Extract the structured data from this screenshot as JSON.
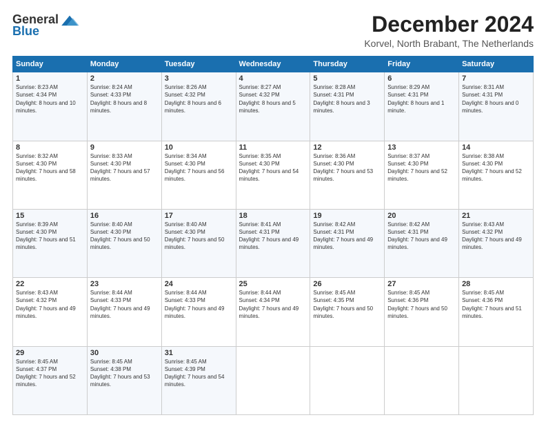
{
  "logo": {
    "general": "General",
    "blue": "Blue"
  },
  "title": "December 2024",
  "subtitle": "Korvel, North Brabant, The Netherlands",
  "weekdays": [
    "Sunday",
    "Monday",
    "Tuesday",
    "Wednesday",
    "Thursday",
    "Friday",
    "Saturday"
  ],
  "weeks": [
    [
      {
        "day": "1",
        "sunrise": "8:23 AM",
        "sunset": "4:34 PM",
        "daylight": "8 hours and 10 minutes."
      },
      {
        "day": "2",
        "sunrise": "8:24 AM",
        "sunset": "4:33 PM",
        "daylight": "8 hours and 8 minutes."
      },
      {
        "day": "3",
        "sunrise": "8:26 AM",
        "sunset": "4:32 PM",
        "daylight": "8 hours and 6 minutes."
      },
      {
        "day": "4",
        "sunrise": "8:27 AM",
        "sunset": "4:32 PM",
        "daylight": "8 hours and 5 minutes."
      },
      {
        "day": "5",
        "sunrise": "8:28 AM",
        "sunset": "4:31 PM",
        "daylight": "8 hours and 3 minutes."
      },
      {
        "day": "6",
        "sunrise": "8:29 AM",
        "sunset": "4:31 PM",
        "daylight": "8 hours and 1 minute."
      },
      {
        "day": "7",
        "sunrise": "8:31 AM",
        "sunset": "4:31 PM",
        "daylight": "8 hours and 0 minutes."
      }
    ],
    [
      {
        "day": "8",
        "sunrise": "8:32 AM",
        "sunset": "4:30 PM",
        "daylight": "7 hours and 58 minutes."
      },
      {
        "day": "9",
        "sunrise": "8:33 AM",
        "sunset": "4:30 PM",
        "daylight": "7 hours and 57 minutes."
      },
      {
        "day": "10",
        "sunrise": "8:34 AM",
        "sunset": "4:30 PM",
        "daylight": "7 hours and 56 minutes."
      },
      {
        "day": "11",
        "sunrise": "8:35 AM",
        "sunset": "4:30 PM",
        "daylight": "7 hours and 54 minutes."
      },
      {
        "day": "12",
        "sunrise": "8:36 AM",
        "sunset": "4:30 PM",
        "daylight": "7 hours and 53 minutes."
      },
      {
        "day": "13",
        "sunrise": "8:37 AM",
        "sunset": "4:30 PM",
        "daylight": "7 hours and 52 minutes."
      },
      {
        "day": "14",
        "sunrise": "8:38 AM",
        "sunset": "4:30 PM",
        "daylight": "7 hours and 52 minutes."
      }
    ],
    [
      {
        "day": "15",
        "sunrise": "8:39 AM",
        "sunset": "4:30 PM",
        "daylight": "7 hours and 51 minutes."
      },
      {
        "day": "16",
        "sunrise": "8:40 AM",
        "sunset": "4:30 PM",
        "daylight": "7 hours and 50 minutes."
      },
      {
        "day": "17",
        "sunrise": "8:40 AM",
        "sunset": "4:30 PM",
        "daylight": "7 hours and 50 minutes."
      },
      {
        "day": "18",
        "sunrise": "8:41 AM",
        "sunset": "4:31 PM",
        "daylight": "7 hours and 49 minutes."
      },
      {
        "day": "19",
        "sunrise": "8:42 AM",
        "sunset": "4:31 PM",
        "daylight": "7 hours and 49 minutes."
      },
      {
        "day": "20",
        "sunrise": "8:42 AM",
        "sunset": "4:31 PM",
        "daylight": "7 hours and 49 minutes."
      },
      {
        "day": "21",
        "sunrise": "8:43 AM",
        "sunset": "4:32 PM",
        "daylight": "7 hours and 49 minutes."
      }
    ],
    [
      {
        "day": "22",
        "sunrise": "8:43 AM",
        "sunset": "4:32 PM",
        "daylight": "7 hours and 49 minutes."
      },
      {
        "day": "23",
        "sunrise": "8:44 AM",
        "sunset": "4:33 PM",
        "daylight": "7 hours and 49 minutes."
      },
      {
        "day": "24",
        "sunrise": "8:44 AM",
        "sunset": "4:33 PM",
        "daylight": "7 hours and 49 minutes."
      },
      {
        "day": "25",
        "sunrise": "8:44 AM",
        "sunset": "4:34 PM",
        "daylight": "7 hours and 49 minutes."
      },
      {
        "day": "26",
        "sunrise": "8:45 AM",
        "sunset": "4:35 PM",
        "daylight": "7 hours and 50 minutes."
      },
      {
        "day": "27",
        "sunrise": "8:45 AM",
        "sunset": "4:36 PM",
        "daylight": "7 hours and 50 minutes."
      },
      {
        "day": "28",
        "sunrise": "8:45 AM",
        "sunset": "4:36 PM",
        "daylight": "7 hours and 51 minutes."
      }
    ],
    [
      {
        "day": "29",
        "sunrise": "8:45 AM",
        "sunset": "4:37 PM",
        "daylight": "7 hours and 52 minutes."
      },
      {
        "day": "30",
        "sunrise": "8:45 AM",
        "sunset": "4:38 PM",
        "daylight": "7 hours and 53 minutes."
      },
      {
        "day": "31",
        "sunrise": "8:45 AM",
        "sunset": "4:39 PM",
        "daylight": "7 hours and 54 minutes."
      },
      null,
      null,
      null,
      null
    ]
  ]
}
